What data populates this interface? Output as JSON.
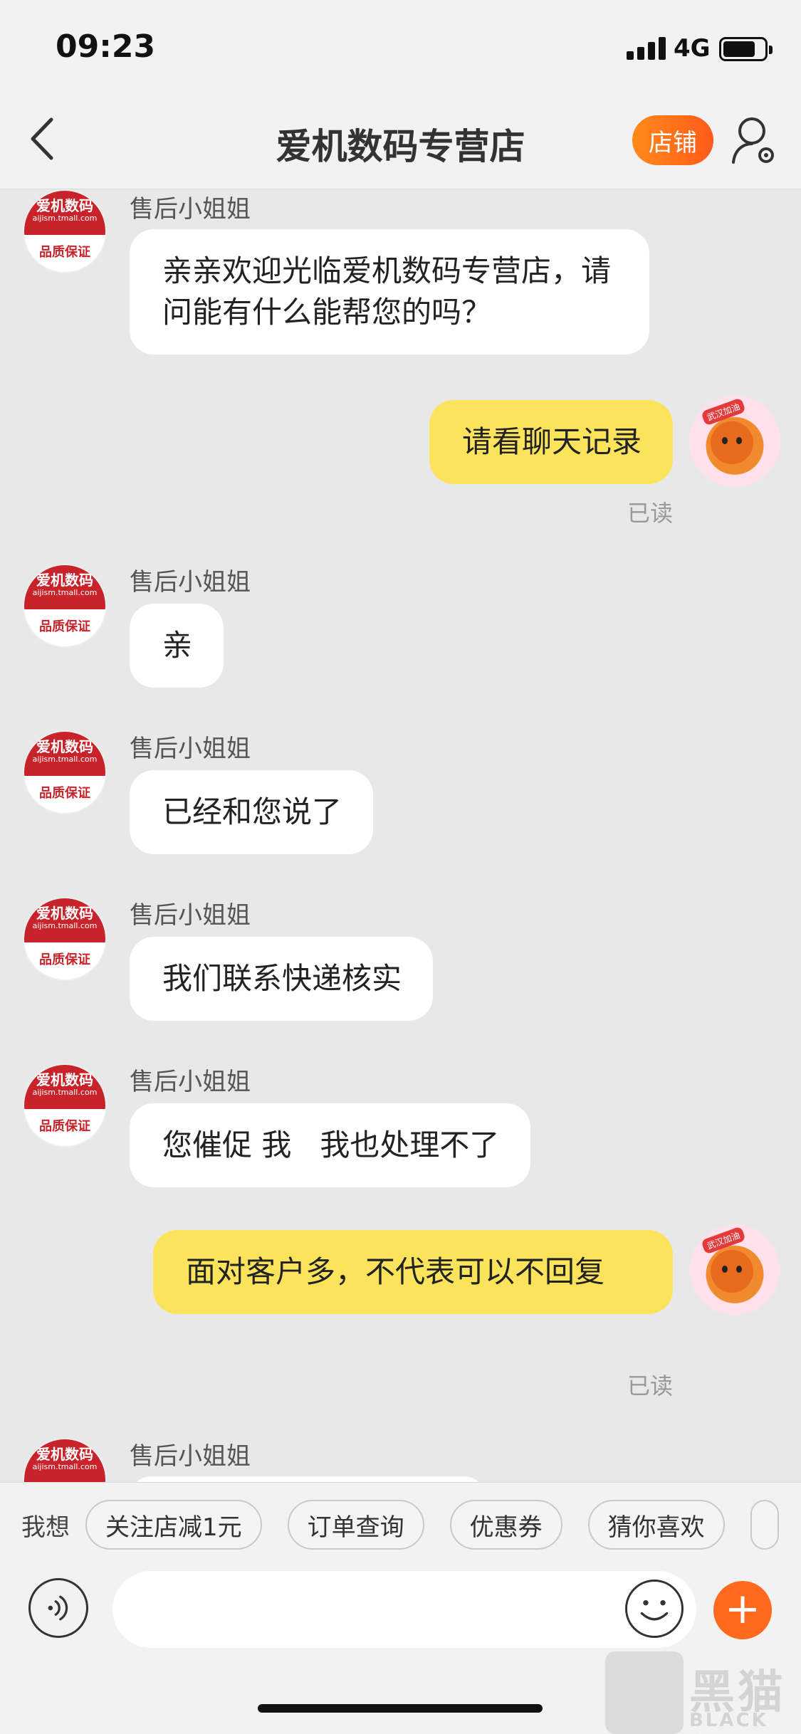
{
  "status_bar": {
    "time": "09:23",
    "network": "4G"
  },
  "header": {
    "title": "爱机数码专营店",
    "shop_button": "店铺"
  },
  "shop_avatar": {
    "name": "爱机数码",
    "domain": "aijism.tmall.com",
    "badge": "品质保证"
  },
  "user_avatar": {
    "tag": "武汉加油"
  },
  "messages": [
    {
      "from": "shop",
      "sender": "售后小姐姐",
      "text": "亲亲欢迎光临爱机数码专营店，请问能有什么能帮您的吗？"
    },
    {
      "from": "user",
      "text": "请看聊天记录",
      "status": "已读"
    },
    {
      "from": "shop",
      "sender": "售后小姐姐",
      "text": "亲"
    },
    {
      "from": "shop",
      "sender": "售后小姐姐",
      "text": "已经和您说了"
    },
    {
      "from": "shop",
      "sender": "售后小姐姐",
      "text": "我们联系快递核实"
    },
    {
      "from": "shop",
      "sender": "售后小姐姐",
      "text": "您催促 我   我也处理不了"
    },
    {
      "from": "user",
      "text": "面对客户多，不代表可以不回复",
      "status": "已读"
    },
    {
      "from": "shop",
      "sender": "售后小姐姐",
      "text": ""
    }
  ],
  "quick_replies": {
    "label": "我想",
    "chips": [
      "关注店减1元",
      "订单查询",
      "优惠券",
      "猜你喜欢"
    ]
  },
  "watermark": {
    "cn": "黑猫",
    "en": "BLACK CAT"
  }
}
